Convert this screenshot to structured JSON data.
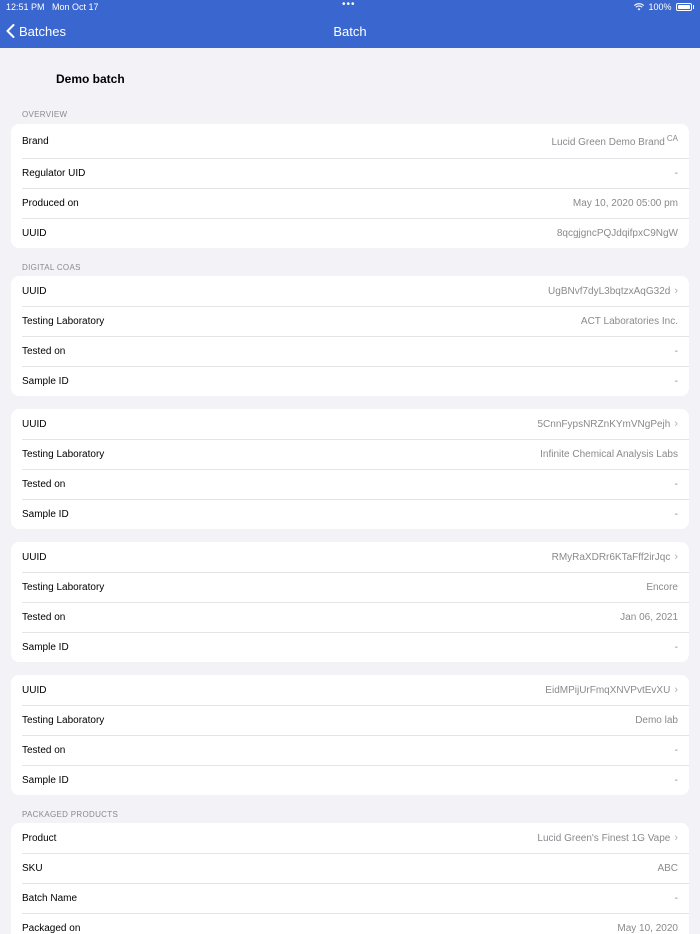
{
  "status_bar": {
    "time": "12:51 PM",
    "date": "Mon Oct 17",
    "battery": "100%"
  },
  "nav": {
    "back_label": "Batches",
    "title": "Batch"
  },
  "heading": "Demo batch",
  "overview": {
    "section_label": "OVERVIEW",
    "brand_label": "Brand",
    "brand_value": "Lucid Green Demo Brand",
    "brand_region": "CA",
    "regulator_label": "Regulator UID",
    "regulator_value": "-",
    "produced_label": "Produced on",
    "produced_value": "May 10, 2020 05:00 pm",
    "uuid_label": "UUID",
    "uuid_value": "8qcgjgncPQJdqifpxC9NgW"
  },
  "digital_coas": {
    "section_label": "DIGITAL COAS",
    "cards": [
      {
        "uuid_label": "UUID",
        "uuid_value": "UgBNvf7dyL3bqtzxAqG32d",
        "lab_label": "Testing Laboratory",
        "lab_value": "ACT Laboratories Inc.",
        "tested_label": "Tested on",
        "tested_value": "-",
        "sample_label": "Sample ID",
        "sample_value": "-"
      },
      {
        "uuid_label": "UUID",
        "uuid_value": "5CnnFypsNRZnKYmVNgPejh",
        "lab_label": "Testing Laboratory",
        "lab_value": "Infinite Chemical Analysis Labs",
        "tested_label": "Tested on",
        "tested_value": "-",
        "sample_label": "Sample ID",
        "sample_value": "-"
      },
      {
        "uuid_label": "UUID",
        "uuid_value": "RMyRaXDRr6KTaFff2irJqc",
        "lab_label": "Testing Laboratory",
        "lab_value": "Encore",
        "tested_label": "Tested on",
        "tested_value": "Jan 06, 2021",
        "sample_label": "Sample ID",
        "sample_value": "-"
      },
      {
        "uuid_label": "UUID",
        "uuid_value": "EidMPijUrFmqXNVPvtEvXU",
        "lab_label": "Testing Laboratory",
        "lab_value": "Demo lab",
        "tested_label": "Tested on",
        "tested_value": "-",
        "sample_label": "Sample ID",
        "sample_value": "-"
      }
    ]
  },
  "packaged_products": {
    "section_label": "PACKAGED PRODUCTS",
    "product_label": "Product",
    "product_value": "Lucid Green's Finest 1G Vape",
    "sku_label": "SKU",
    "sku_value": "ABC",
    "batch_name_label": "Batch Name",
    "batch_name_value": "-",
    "packaged_label": "Packaged on",
    "packaged_value": "May 10, 2020"
  },
  "icons": {
    "back": "chevron-left-icon",
    "disclosure": "chevron-right-icon",
    "wifi": "wifi-icon",
    "battery": "battery-icon",
    "multitask": "multitasking-dots-icon"
  },
  "colors": {
    "nav_background": "#3a66cf",
    "page_background": "#f2f2f7",
    "secondary_text": "#8a8a8e"
  }
}
